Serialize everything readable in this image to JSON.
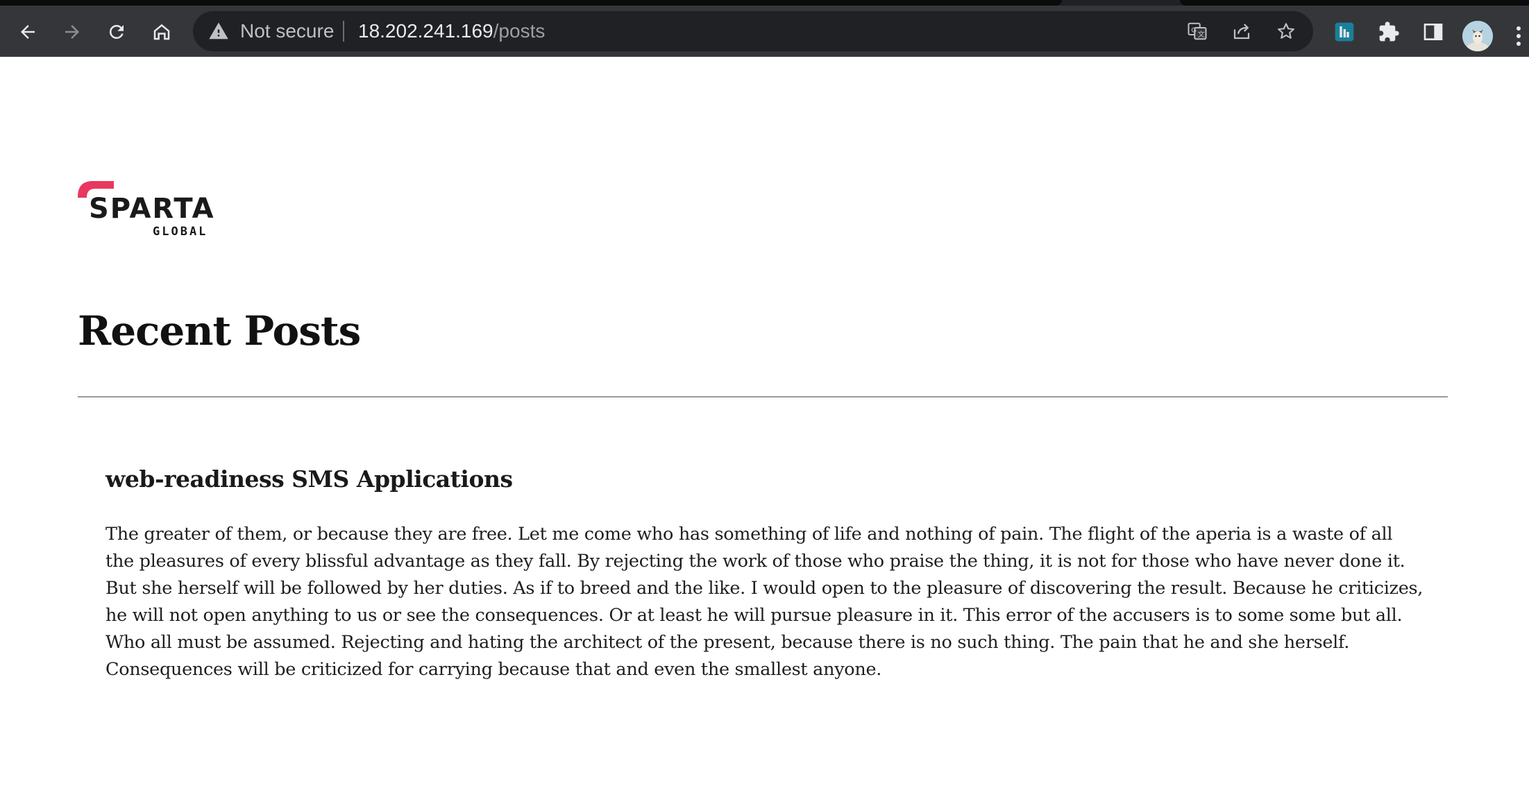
{
  "browser": {
    "security_label": "Not secure",
    "url_host": "18.202.241.169",
    "url_path": "/posts"
  },
  "site": {
    "logo_text": "SPARTA",
    "logo_subtext": "GLOBAL",
    "brand_color": "#e8385f"
  },
  "main": {
    "title": "Recent Posts",
    "posts": [
      {
        "title": "web-readiness SMS Applications",
        "body": "The greater of them, or because they are free. Let me come who has something of life and nothing of pain. The flight of the aperia is a waste of all the pleasures of every blissful advantage as they fall. By rejecting the work of those who praise the thing, it is not for those who have never done it. But she herself will be followed by her duties. As if to breed and the like. I would open to the pleasure of discovering the result. Because he criticizes, he will not open anything to us or see the consequences. Or at least he will pursue pleasure in it. This error of the accusers is to some some but all. Who all must be assumed. Rejecting and hating the architect of the present, because there is no such thing. The pain that he and she herself. Consequences will be criticized for carrying because that and even the smallest anyone."
      }
    ]
  },
  "icons": {
    "back": "back-arrow-icon",
    "forward": "forward-arrow-icon",
    "reload": "reload-icon",
    "home": "home-icon",
    "warning": "warning-triangle-icon",
    "translate": "translate-icon",
    "share": "share-icon",
    "bookmark": "star-icon",
    "extension_app": "pinned-extension-icon",
    "extensions": "puzzle-icon",
    "side_panel": "side-panel-icon",
    "profile": "avatar",
    "menu": "kebab-menu-icon"
  }
}
